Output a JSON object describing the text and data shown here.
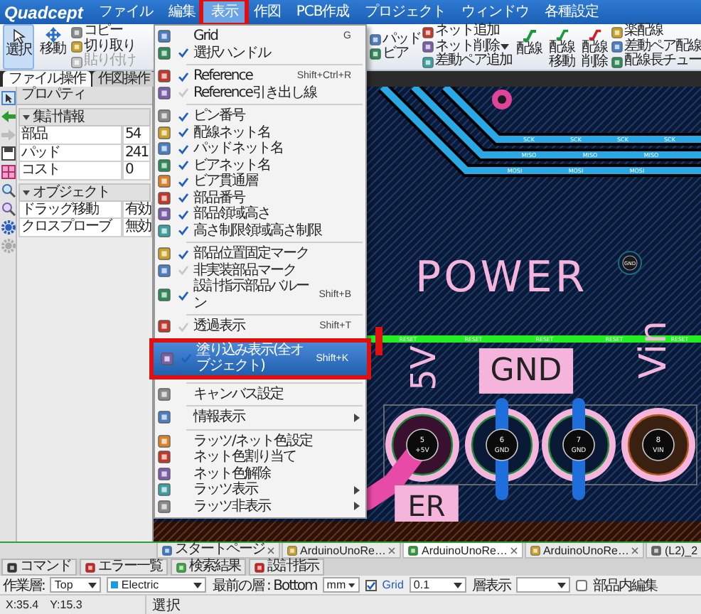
{
  "menubar": {
    "logo": "Quadcept",
    "items": [
      {
        "label": "ファイル",
        "selected": false,
        "annotated": false
      },
      {
        "label": "編集",
        "selected": false,
        "annotated": false
      },
      {
        "label": "表示",
        "selected": true,
        "annotated": true
      },
      {
        "label": "作図",
        "selected": false,
        "annotated": false
      },
      {
        "label": "PCB作成",
        "selected": false,
        "annotated": false
      },
      {
        "label": "プロジェクト",
        "selected": false,
        "annotated": false
      },
      {
        "label": "ウィンドウ",
        "selected": false,
        "annotated": false
      },
      {
        "label": "各種設定",
        "selected": false,
        "annotated": false
      }
    ]
  },
  "ribbon": {
    "left_groups": [
      {
        "kind": "large",
        "label": "選択",
        "selected": true
      },
      {
        "kind": "large",
        "label": "移動",
        "selected": false
      },
      {
        "kind": "stack",
        "items": [
          {
            "label": "コピー",
            "disabled": false,
            "dropdown": false
          },
          {
            "label": "切り取り",
            "disabled": false,
            "dropdown": false
          },
          {
            "label": "貼り付け",
            "disabled": true,
            "dropdown": false
          }
        ]
      }
    ],
    "right_groups": [
      {
        "kind": "stack",
        "items": [
          {
            "label": "パッド",
            "disabled": false,
            "dropdown": false
          },
          {
            "label": "ビア",
            "disabled": false,
            "dropdown": false
          }
        ]
      },
      {
        "kind": "stack",
        "items": [
          {
            "label": "ネット追加",
            "disabled": false,
            "dropdown": false
          },
          {
            "label": "ネット削除",
            "disabled": false,
            "dropdown": true
          },
          {
            "label": "差動ペア追加",
            "disabled": false,
            "dropdown": false
          }
        ]
      },
      {
        "kind": "large",
        "label": "配線",
        "selected": false
      },
      {
        "kind": "large",
        "label": "配線移動",
        "selected": false
      },
      {
        "kind": "large",
        "label": "配線削除",
        "selected": false
      },
      {
        "kind": "stack",
        "items": [
          {
            "label": "楽配線",
            "disabled": false,
            "dropdown": false
          },
          {
            "label": "差動ペア配線",
            "disabled": false,
            "dropdown": false
          },
          {
            "label": "配線長チュー",
            "disabled": false,
            "dropdown": false
          }
        ]
      }
    ]
  },
  "ribbon_tabs": [
    {
      "label": "ファイル操作",
      "selected": true
    },
    {
      "label": "作図操作",
      "selected": false
    }
  ],
  "properties": {
    "title": "プロパティ",
    "groups": [
      {
        "title": "集計情報",
        "expanded": true,
        "rows": [
          {
            "name": "部品",
            "value": "54"
          },
          {
            "name": "パッド",
            "value": "241"
          },
          {
            "name": "コスト",
            "value": "0"
          }
        ]
      },
      {
        "title": "オブジェクト",
        "expanded": true,
        "rows": [
          {
            "name": "ドラッグ移動",
            "value": "有効"
          },
          {
            "name": "クロスプローブ",
            "value": "無効"
          }
        ]
      }
    ]
  },
  "view_menu": {
    "items": [
      {
        "kind": "command",
        "label": "Grid",
        "shortcut": "G",
        "selected": false,
        "annotated": false
      },
      {
        "kind": "toggle",
        "label": "選択ハンドル",
        "checked": true,
        "selected": false,
        "annotated": false
      },
      {
        "kind": "separator"
      },
      {
        "kind": "toggle",
        "label": "Reference",
        "shortcut": "Shift+Ctrl+R",
        "checked": true,
        "selected": false,
        "annotated": false
      },
      {
        "kind": "toggle",
        "label": "Reference引き出し線",
        "checked": false,
        "selected": false,
        "annotated": false
      },
      {
        "kind": "separator"
      },
      {
        "kind": "toggle",
        "label": "ピン番号",
        "checked": true,
        "selected": false,
        "annotated": false
      },
      {
        "kind": "toggle",
        "label": "配線ネット名",
        "checked": true,
        "selected": false,
        "annotated": false
      },
      {
        "kind": "toggle",
        "label": "パッドネット名",
        "checked": true,
        "selected": false,
        "annotated": false
      },
      {
        "kind": "toggle",
        "label": "ビアネット名",
        "checked": true,
        "selected": false,
        "annotated": false
      },
      {
        "kind": "toggle",
        "label": "ビア貫通層",
        "checked": true,
        "selected": false,
        "annotated": false
      },
      {
        "kind": "toggle",
        "label": "部品番号",
        "checked": true,
        "selected": false,
        "annotated": false
      },
      {
        "kind": "toggle",
        "label": "部品領域高さ",
        "checked": true,
        "selected": false,
        "annotated": false
      },
      {
        "kind": "toggle",
        "label": "高さ制限領域高さ制限",
        "checked": true,
        "selected": false,
        "annotated": false
      },
      {
        "kind": "separator"
      },
      {
        "kind": "toggle",
        "label": "部品位置固定マーク",
        "checked": true,
        "selected": false,
        "annotated": false
      },
      {
        "kind": "toggle",
        "label": "非実装部品マーク",
        "checked": false,
        "selected": false,
        "annotated": false
      },
      {
        "kind": "toggle",
        "label": "設計指示部品バルーン",
        "shortcut": "Shift+B",
        "checked": true,
        "selected": false,
        "annotated": false
      },
      {
        "kind": "separator"
      },
      {
        "kind": "toggle",
        "label": "透過表示",
        "shortcut": "Shift+T",
        "checked": false,
        "selected": false,
        "annotated": false
      },
      {
        "kind": "toggle",
        "label": "塗り込み表示(全オブジェクト)",
        "shortcut": "Shift+K",
        "checked": true,
        "selected": true,
        "annotated": true
      },
      {
        "kind": "separator"
      },
      {
        "kind": "command",
        "label": "キャンバス設定",
        "selected": false,
        "annotated": false
      },
      {
        "kind": "separator"
      },
      {
        "kind": "submenu",
        "label": "情報表示",
        "selected": false,
        "annotated": false
      },
      {
        "kind": "separator"
      },
      {
        "kind": "command",
        "label": "ラッツ/ネット色設定",
        "selected": false,
        "annotated": false
      },
      {
        "kind": "command",
        "label": "ネット色割り当て",
        "selected": false,
        "annotated": false
      },
      {
        "kind": "command",
        "label": "ネット色解除",
        "selected": false,
        "annotated": false
      },
      {
        "kind": "submenu",
        "label": "ラッツ表示",
        "selected": false,
        "annotated": false
      },
      {
        "kind": "submenu",
        "label": "ラッツ非表示",
        "selected": false,
        "annotated": false
      }
    ]
  },
  "pcb": {
    "traces": [
      {
        "labels": [
          "SCK",
          "SCK",
          "SCK",
          "SCK"
        ]
      },
      {
        "labels": [
          "MISO",
          "MISO",
          "MISO"
        ]
      },
      {
        "labels": [
          "MOSI",
          "MOSI",
          "MOSI"
        ]
      }
    ],
    "reset_trace": {
      "labels": [
        "RESET",
        "RESET",
        "RESET",
        "RESET",
        "RESET"
      ]
    },
    "via_label": "GND",
    "silkscreen": [
      {
        "kind": "title",
        "text": "POWER"
      },
      {
        "kind": "vertical",
        "text": "5V"
      },
      {
        "kind": "box",
        "text": "GND"
      },
      {
        "kind": "vertical",
        "text": "Vin"
      },
      {
        "kind": "box",
        "text": "ER"
      }
    ],
    "pins": [
      {
        "number": "5",
        "net": "+5V"
      },
      {
        "number": "6",
        "net": "GND"
      },
      {
        "number": "7",
        "net": "GND"
      },
      {
        "number": "8",
        "net": "VIN"
      }
    ]
  },
  "document_tabs": [
    {
      "label": "スタートページ",
      "selected": false
    },
    {
      "label": "ArduinoUnoRe…",
      "selected": false
    },
    {
      "label": "ArduinoUnoRe…",
      "selected": true
    },
    {
      "label": "ArduinoUnoRe…",
      "selected": false
    },
    {
      "label": "(L2)_2",
      "selected": false
    }
  ],
  "panel_tabs": [
    {
      "label": "コマンド",
      "selected": false
    },
    {
      "label": "エラー一覧",
      "selected": false
    },
    {
      "label": "検索結果",
      "selected": false
    },
    {
      "label": "設計指示",
      "selected": false
    }
  ],
  "layer_toolbar": {
    "work_layer_label": "作業層:",
    "work_layer": "Top",
    "layer_set": "Electric",
    "front_layer_label": "最前の層 : Bottom",
    "unit": "mm",
    "grid_checked": true,
    "grid_label": "Grid",
    "grid_value": "0.1",
    "layer_display_label": "層表示",
    "inner_edit_checked": false,
    "inner_edit_label": "部品内編集"
  },
  "status_bar": {
    "x": "X:35.4",
    "y": "Y:15.3",
    "mode": "選択"
  }
}
